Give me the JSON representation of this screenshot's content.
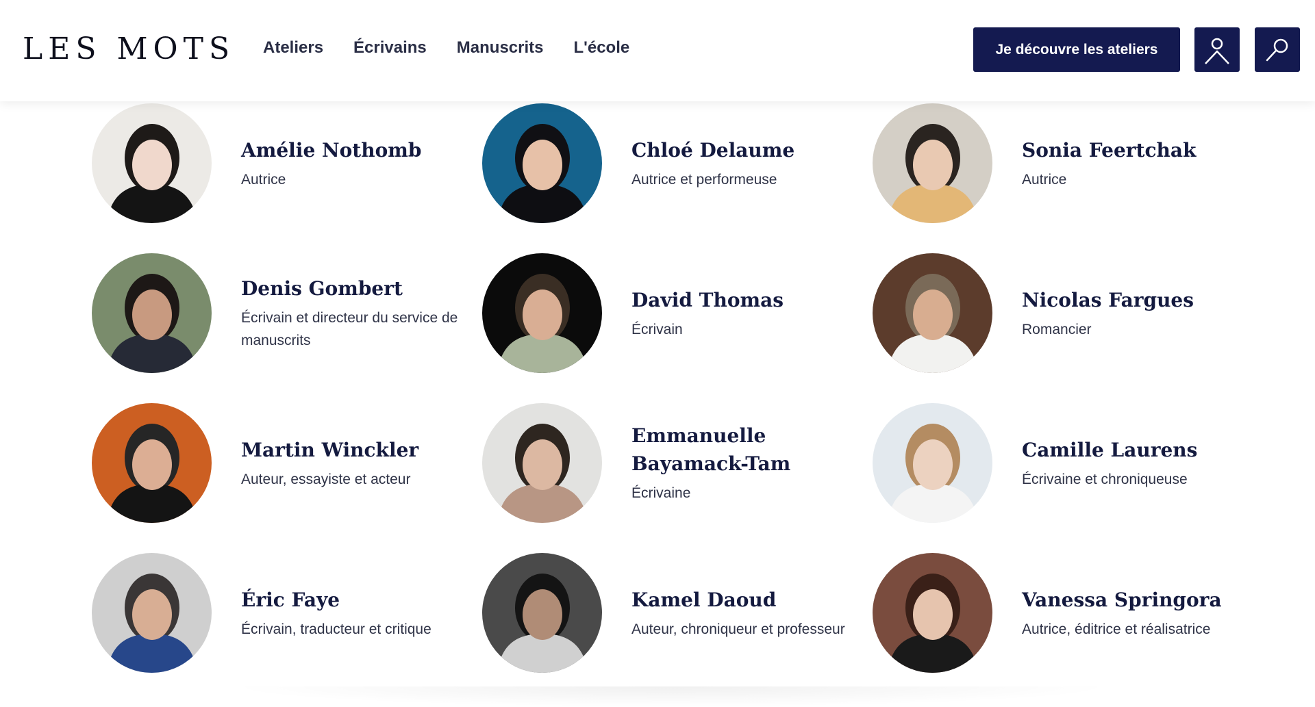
{
  "header": {
    "logo": "LES MOTS",
    "nav": [
      "Ateliers",
      "Écrivains",
      "Manuscrits",
      "L'école"
    ],
    "cta_label": "Je découvre les ateliers",
    "account_icon": "user-icon",
    "search_icon": "search-icon",
    "brand_color": "#141a50"
  },
  "writers": [
    {
      "name": "Amélie Nothomb",
      "role": "Autrice",
      "bg": "#eceae6",
      "skin": "#f0d8cc",
      "hair": "#1e1a18",
      "cloth": "#141414"
    },
    {
      "name": "Chloé Delaume",
      "role": "Autrice et performeuse",
      "bg": "#15638d",
      "skin": "#e7c1a8",
      "hair": "#101014",
      "cloth": "#0e0e12"
    },
    {
      "name": "Sonia Feertchak",
      "role": "Autrice",
      "bg": "#d4cfc6",
      "skin": "#e9c9b2",
      "hair": "#2a2420",
      "cloth": "#e3b776"
    },
    {
      "name": "Denis Gombert",
      "role": "Écrivain et directeur du service de manuscrits",
      "bg": "#7a8c6c",
      "skin": "#c89a80",
      "hair": "#1d1816",
      "cloth": "#262a36"
    },
    {
      "name": "David Thomas",
      "role": "Écrivain",
      "bg": "#0b0b0b",
      "skin": "#d9ae94",
      "hair": "#3a2e24",
      "cloth": "#a8b49a"
    },
    {
      "name": "Nicolas Fargues",
      "role": "Romancier",
      "bg": "#5c3c2c",
      "skin": "#d8ad90",
      "hair": "#7a6a58",
      "cloth": "#f2f2f0"
    },
    {
      "name": "Martin Winckler",
      "role": "Auteur, essayiste et acteur",
      "bg": "#cc5f22",
      "skin": "#dcae94",
      "hair": "#262626",
      "cloth": "#141414"
    },
    {
      "name": "Emmanuelle Bayamack-Tam",
      "role": "Écrivaine",
      "bg": "#e2e2e0",
      "skin": "#dcb8a2",
      "hair": "#2e2620",
      "cloth": "#b89684"
    },
    {
      "name": "Camille Laurens",
      "role": "Écrivaine et chroniqueuse",
      "bg": "#e3e9ee",
      "skin": "#ecd2c0",
      "hair": "#b48c62",
      "cloth": "#f4f4f4"
    },
    {
      "name": "Éric Faye",
      "role": "Écrivain, traducteur et critique",
      "bg": "#cfcfcf",
      "skin": "#d8ae94",
      "hair": "#3a3636",
      "cloth": "#27478a"
    },
    {
      "name": "Kamel Daoud",
      "role": "Auteur, chroniqueur et professeur",
      "bg": "#4a4a4a",
      "skin": "#b08c76",
      "hair": "#141414",
      "cloth": "#d0d0d0"
    },
    {
      "name": "Vanessa Springora",
      "role": "Autrice, éditrice et réalisatrice",
      "bg": "#7a4c3e",
      "skin": "#e6c4ae",
      "hair": "#3a2018",
      "cloth": "#1a1a1a"
    }
  ]
}
